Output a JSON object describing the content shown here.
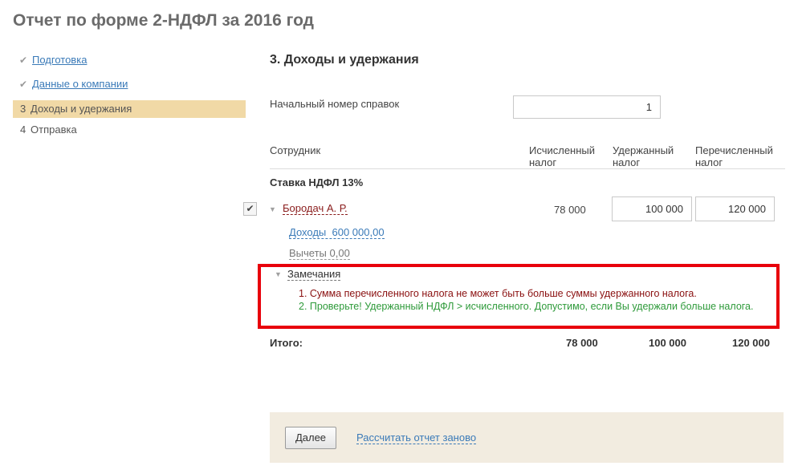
{
  "page": {
    "title": "Отчет по форме 2-НДФЛ за 2016 год"
  },
  "steps": [
    {
      "label": "Подготовка",
      "state": "done"
    },
    {
      "label": "Данные о компании",
      "state": "done"
    },
    {
      "number": "3",
      "label": "Доходы и удержания",
      "state": "current"
    },
    {
      "number": "4",
      "label": "Отправка",
      "state": "todo"
    }
  ],
  "section": {
    "title": "3. Доходы и удержания"
  },
  "start_number": {
    "label": "Начальный номер справок",
    "value": "1"
  },
  "table": {
    "columns": {
      "employee": "Сотрудник",
      "calculated": [
        "Исчисленный",
        "налог"
      ],
      "withheld": [
        "Удержанный",
        "налог"
      ],
      "transferred": [
        "Перечисленный",
        "налог"
      ]
    },
    "rate_group": "Ставка НДФЛ 13%",
    "employee": {
      "name": "Бородач А. Р.",
      "calculated": "78 000",
      "withheld": "100 000",
      "transferred": "120 000",
      "income_link": "Доходы  600 000,00",
      "deductions_link": "Вычеты 0,00"
    },
    "remarks": {
      "title": "Замечания",
      "items": [
        "1. Сумма перечисленного налога не может быть больше суммы удержанного налога.",
        "2. Проверьте! Удержанный НДФЛ > исчисленного. Допустимо, если Вы удержали больше налога."
      ],
      "colors": {
        "error": "#8a1010",
        "warning": "#2e9a3a",
        "highlight_border": "#e8000b"
      }
    },
    "totals": {
      "label": "Итого:",
      "calculated": "78 000",
      "withheld": "100 000",
      "transferred": "120 000"
    }
  },
  "footer": {
    "next_button": "Далее",
    "recalc_link": "Рассчитать отчет заново"
  },
  "icons": {
    "done_step": "check-icon",
    "checkbox": "checkmark-icon",
    "expand": "triangle-down-icon"
  }
}
